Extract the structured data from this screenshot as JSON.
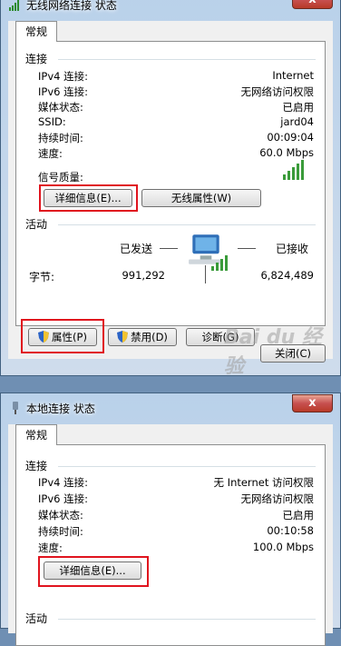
{
  "window1": {
    "title": "无线网络连接 状态",
    "close_glyph": "x",
    "tab": "常规",
    "connection_section": "连接",
    "rows": [
      {
        "label": "IPv4 连接:",
        "value": "Internet"
      },
      {
        "label": "IPv6 连接:",
        "value": "无网络访问权限"
      },
      {
        "label": "媒体状态:",
        "value": "已启用"
      },
      {
        "label": "SSID:",
        "value": "jard04"
      },
      {
        "label": "持续时间:",
        "value": "00:09:04"
      },
      {
        "label": "速度:",
        "value": "60.0 Mbps"
      }
    ],
    "signal_label": "信号质量:",
    "details_button": "详细信息(E)...",
    "wireless_props_button": "无线属性(W)",
    "activity_section": "活动",
    "sent_label": "已发送",
    "received_label": "已接收",
    "bytes_label": "字节:",
    "bytes_sent": "991,292",
    "bytes_received": "6,824,489",
    "properties_button": "属性(P)",
    "disable_button": "禁用(D)",
    "diagnose_button": "诊断(G)",
    "close_button": "关闭(C)"
  },
  "window2": {
    "title": "本地连接 状态",
    "close_glyph": "x",
    "tab": "常规",
    "connection_section": "连接",
    "rows": [
      {
        "label": "IPv4 连接:",
        "value": "无 Internet 访问权限"
      },
      {
        "label": "IPv6 连接:",
        "value": "无网络访问权限"
      },
      {
        "label": "媒体状态:",
        "value": "已启用"
      },
      {
        "label": "持续时间:",
        "value": "00:10:58"
      },
      {
        "label": "速度:",
        "value": "100.0 Mbps"
      }
    ],
    "details_button": "详细信息(E)...",
    "activity_section": "活动"
  },
  "watermark": "Bai du 经验"
}
